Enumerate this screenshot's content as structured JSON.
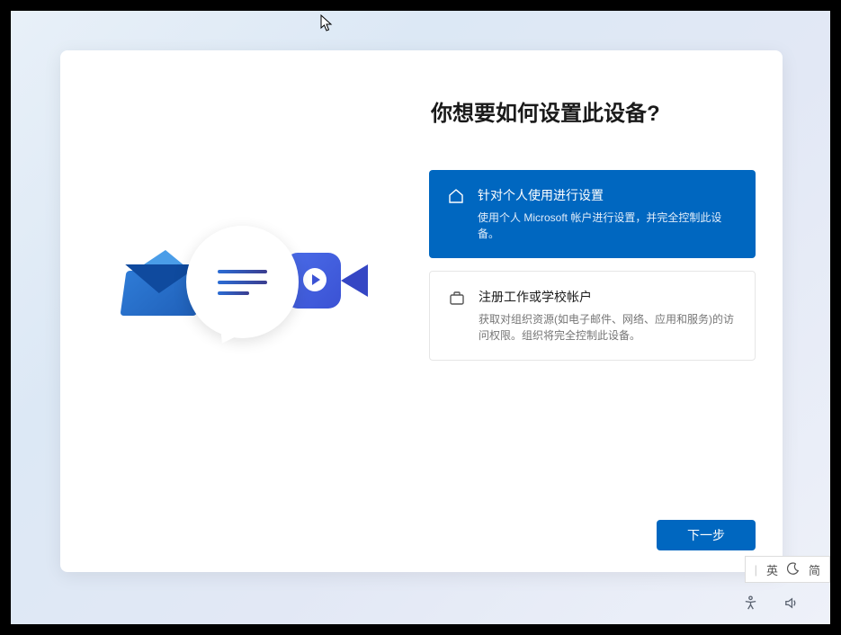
{
  "title": "你想要如何设置此设备?",
  "options": {
    "personal": {
      "title": "针对个人使用进行设置",
      "description": "使用个人 Microsoft 帐户进行设置，并完全控制此设备。"
    },
    "work": {
      "title": "注册工作或学校帐户",
      "description": "获取对组织资源(如电子邮件、网络、应用和服务)的访问权限。组织将完全控制此设备。"
    }
  },
  "next_button": "下一步",
  "ime": {
    "lang1": "英",
    "lang2": "简"
  }
}
